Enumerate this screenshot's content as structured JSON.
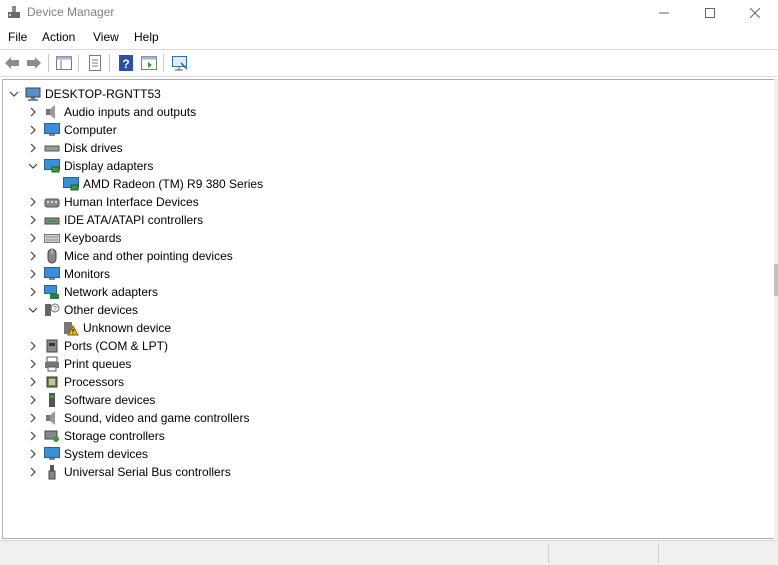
{
  "window": {
    "title": "Device Manager"
  },
  "menu": [
    "File",
    "Action",
    "View",
    "Help"
  ],
  "tree": {
    "root": "DESKTOP-RGNTT53",
    "items": [
      {
        "label": "Audio inputs and outputs",
        "icon": "speaker-icon",
        "expanded": false,
        "children": []
      },
      {
        "label": "Computer",
        "icon": "computer-icon",
        "expanded": false,
        "children": []
      },
      {
        "label": "Disk drives",
        "icon": "disk-drive-icon",
        "expanded": false,
        "children": []
      },
      {
        "label": "Display adapters",
        "icon": "display-adapter-icon",
        "expanded": true,
        "children": [
          {
            "label": "AMD Radeon (TM) R9 380 Series",
            "icon": "display-adapter-icon"
          }
        ]
      },
      {
        "label": "Human Interface Devices",
        "icon": "hid-icon",
        "expanded": false,
        "children": []
      },
      {
        "label": "IDE ATA/ATAPI controllers",
        "icon": "ide-controller-icon",
        "expanded": false,
        "children": []
      },
      {
        "label": "Keyboards",
        "icon": "keyboard-icon",
        "expanded": false,
        "children": []
      },
      {
        "label": "Mice and other pointing devices",
        "icon": "mouse-icon",
        "expanded": false,
        "children": []
      },
      {
        "label": "Monitors",
        "icon": "monitor-icon",
        "expanded": false,
        "children": []
      },
      {
        "label": "Network adapters",
        "icon": "network-adapter-icon",
        "expanded": false,
        "children": []
      },
      {
        "label": "Other devices",
        "icon": "other-devices-icon",
        "expanded": true,
        "children": [
          {
            "label": "Unknown device",
            "icon": "unknown-device-warning-icon"
          }
        ]
      },
      {
        "label": "Ports (COM & LPT)",
        "icon": "port-icon",
        "expanded": false,
        "children": []
      },
      {
        "label": "Print queues",
        "icon": "printer-icon",
        "expanded": false,
        "children": []
      },
      {
        "label": "Processors",
        "icon": "processor-icon",
        "expanded": false,
        "children": []
      },
      {
        "label": "Software devices",
        "icon": "software-device-icon",
        "expanded": false,
        "children": []
      },
      {
        "label": "Sound, video and game controllers",
        "icon": "speaker-icon",
        "expanded": false,
        "children": []
      },
      {
        "label": "Storage controllers",
        "icon": "storage-controller-icon",
        "expanded": false,
        "children": []
      },
      {
        "label": "System devices",
        "icon": "system-device-icon",
        "expanded": false,
        "children": []
      },
      {
        "label": "Universal Serial Bus controllers",
        "icon": "usb-icon",
        "expanded": false,
        "children": []
      }
    ]
  },
  "colors": {
    "accent": "#1e73be",
    "warning": "#f5c211",
    "border": "#adadad"
  }
}
